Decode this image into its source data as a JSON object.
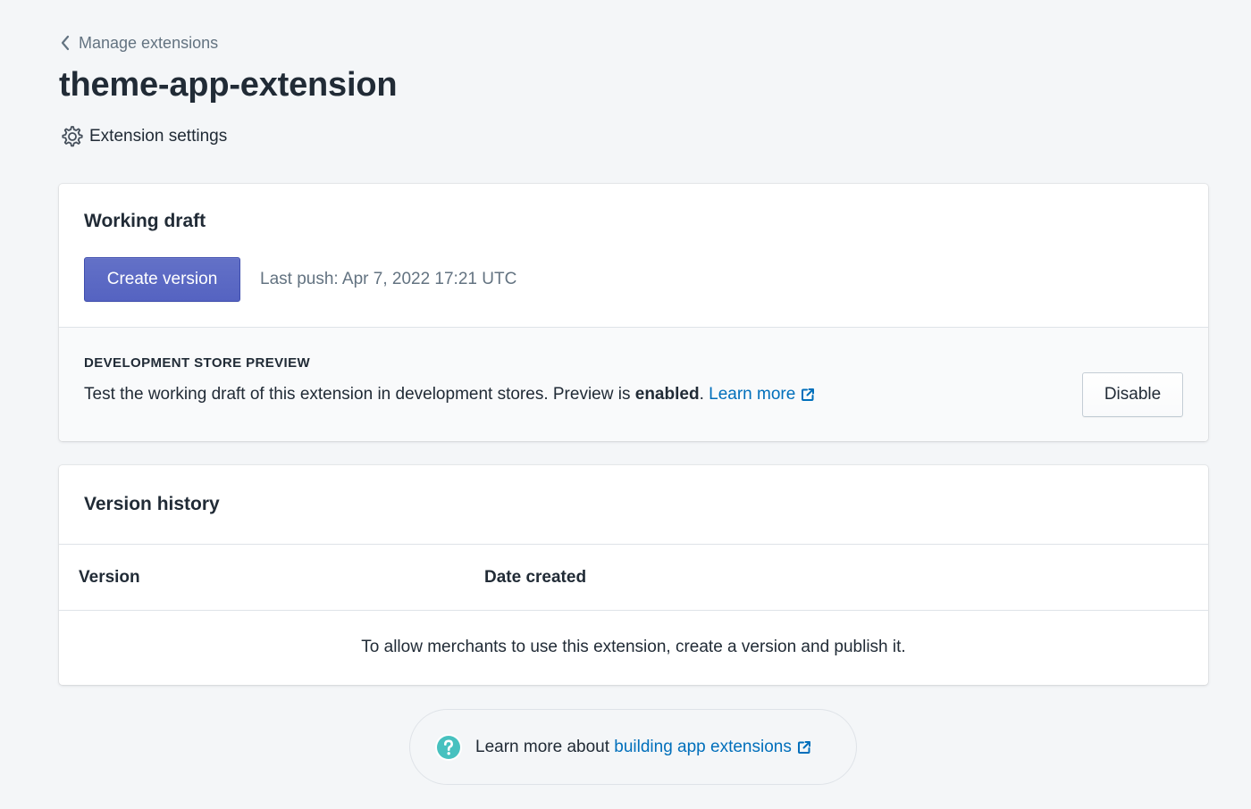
{
  "header": {
    "breadcrumb_label": "Manage extensions",
    "title": "theme-app-extension",
    "settings_label": "Extension settings"
  },
  "working_draft": {
    "title": "Working draft",
    "create_button_label": "Create version",
    "last_push": "Last push: Apr 7, 2022 17:21 UTC",
    "preview": {
      "heading": "DEVELOPMENT STORE PREVIEW",
      "text_before": "Test the working draft of this extension in development stores. Preview is ",
      "status": "enabled",
      "text_after": ". ",
      "learn_more_label": "Learn more",
      "disable_button_label": "Disable"
    }
  },
  "version_history": {
    "title": "Version history",
    "columns": [
      "Version",
      "Date created"
    ],
    "empty_message": "To allow merchants to use this extension, create a version and publish it."
  },
  "footer": {
    "text": "Learn more about ",
    "link_label": "building app extensions"
  },
  "colors": {
    "background": "#f4f6f8",
    "primary": "#5c6ac4",
    "link": "#006fbb",
    "help_icon": "#47c1bf"
  },
  "icons": {
    "breadcrumb": "chevron-left-icon",
    "settings": "gear-icon",
    "external_link": "external-link-icon",
    "help": "question-circle-icon"
  }
}
